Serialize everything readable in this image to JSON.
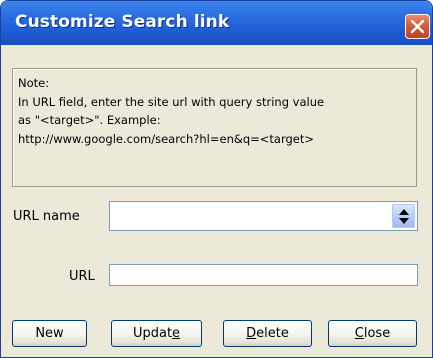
{
  "window": {
    "title": "Customize Search link",
    "close_icon": "close-icon"
  },
  "note": {
    "lines": [
      "Note:",
      "In URL field, enter the site url with query string value",
      "as \"<target>\". Example:",
      "http://www.google.com/search?hl=en&q=<target>"
    ]
  },
  "form": {
    "url_name_label": "URL name",
    "url_name_value": "",
    "combo_icon": "spinner-updown-icon",
    "url_label": "URL",
    "url_value": ""
  },
  "buttons": {
    "new": "New",
    "update": {
      "before": "Updat",
      "underlined": "e",
      "after": ""
    },
    "delete": {
      "before": "",
      "underlined": "D",
      "after": "elete"
    },
    "close": {
      "before": "",
      "underlined": "C",
      "after": "lose"
    }
  },
  "colors": {
    "titlebar": "#2a6de0",
    "close_button": "#d65a3a",
    "dialog_background": "#ece9d8",
    "input_border": "#7f9db9"
  }
}
